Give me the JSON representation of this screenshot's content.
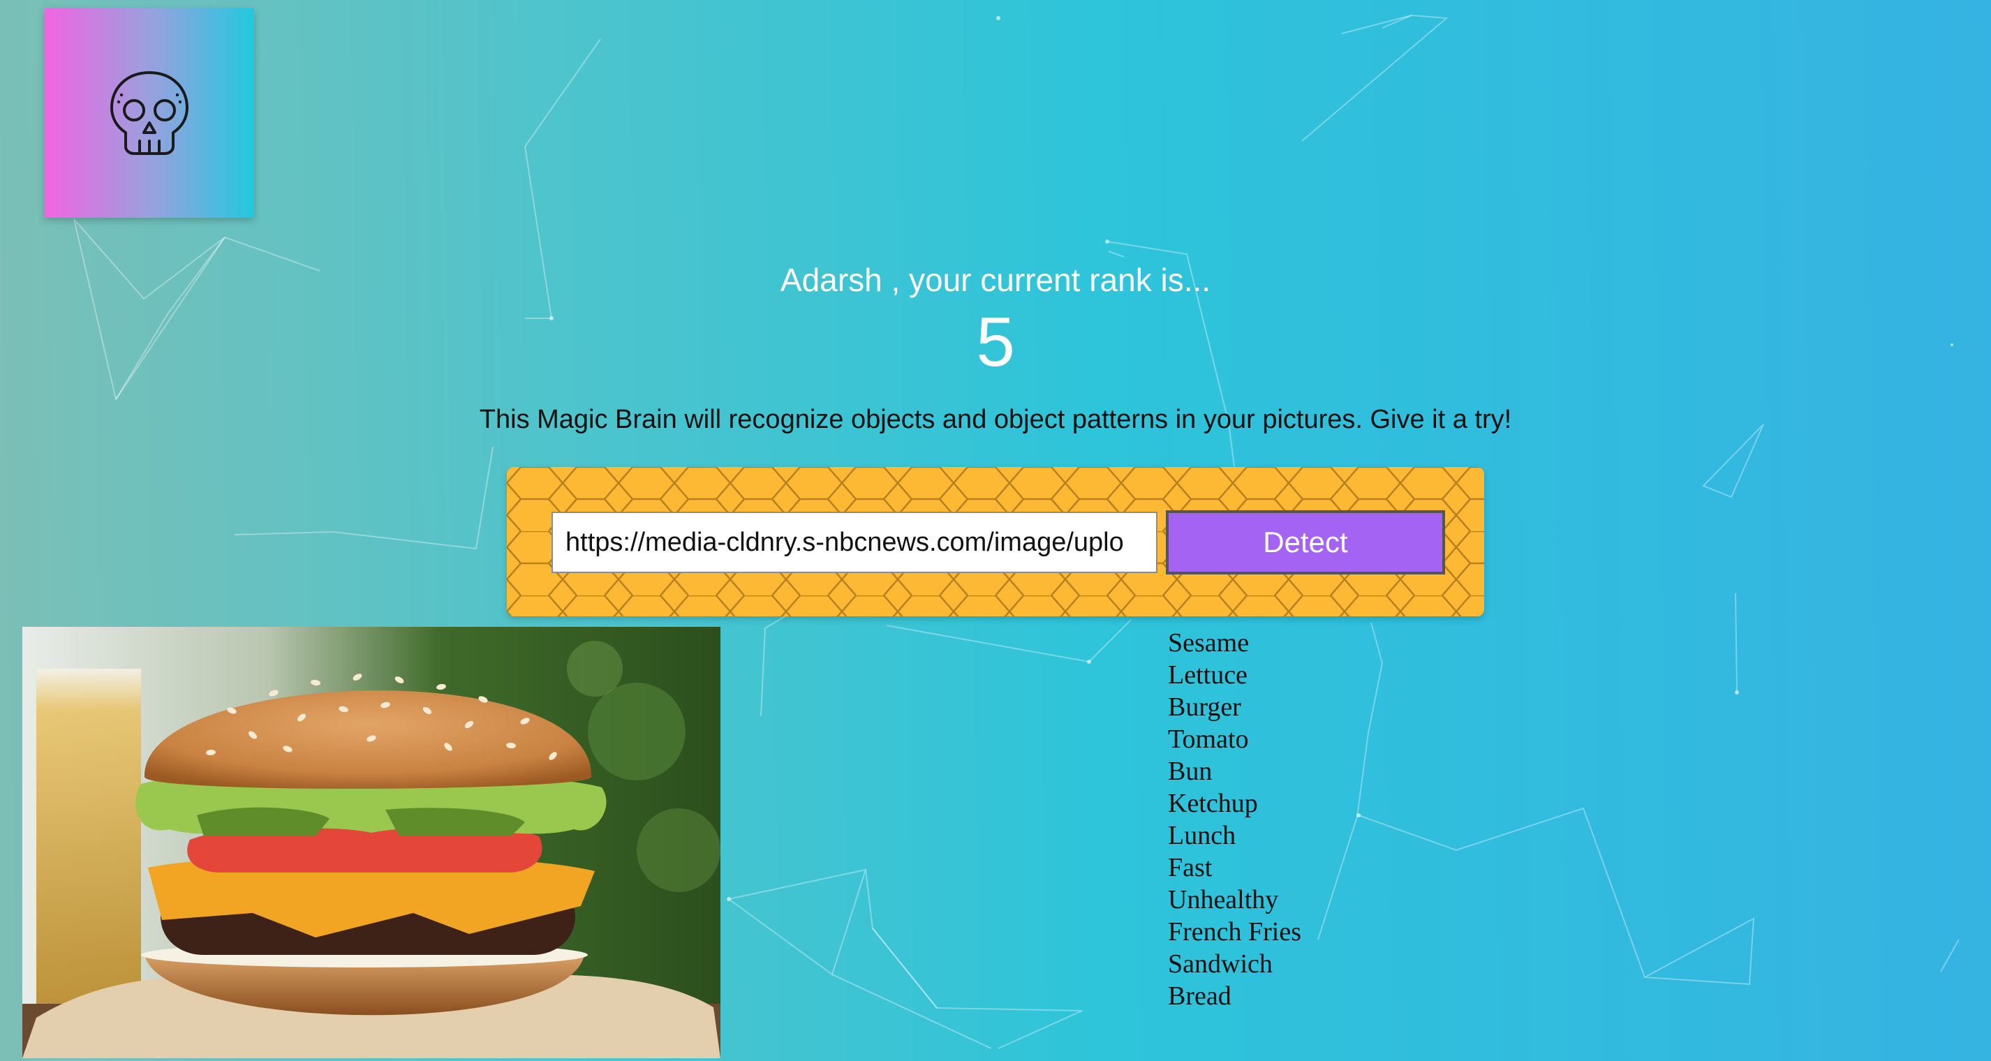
{
  "app": {
    "logo_icon": "skull-icon"
  },
  "rank": {
    "message": "Adarsh , your current rank is...",
    "value": "5"
  },
  "intro": {
    "text": "This Magic Brain will recognize objects and object patterns in your pictures. Give it a try!"
  },
  "form": {
    "url_value": "https://media-cldnry.s-nbcnews.com/image/uplo",
    "detect_label": "Detect",
    "panel_color": "#fdb834",
    "button_color": "#a463f2"
  },
  "result": {
    "image_subject": "burger-photo",
    "concepts": [
      "Sesame",
      "Lettuce",
      "Burger",
      "Tomato",
      "Bun",
      "Ketchup",
      "Lunch",
      "Fast",
      "Unhealthy",
      "French Fries",
      "Sandwich",
      "Bread"
    ]
  }
}
